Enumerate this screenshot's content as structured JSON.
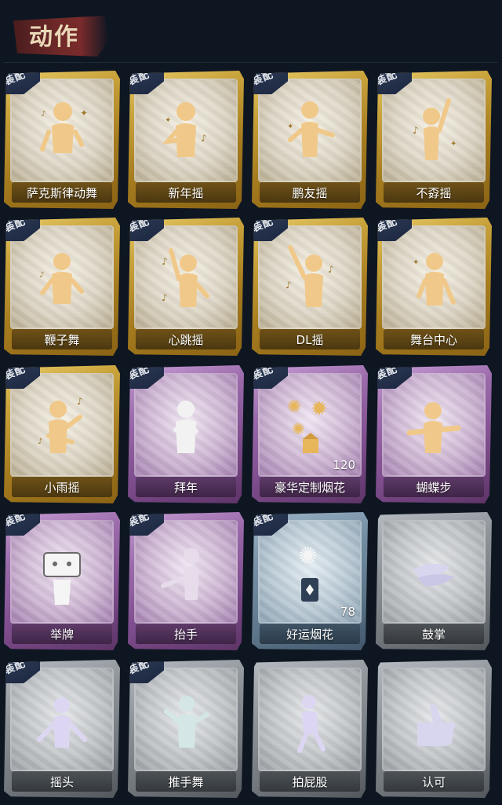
{
  "header": {
    "title": "动作"
  },
  "equip_label": "装配",
  "cards": [
    {
      "name": "萨克斯律动舞",
      "tier": "gold",
      "equipped": true,
      "icon": "saxophone-dance-icon"
    },
    {
      "name": "新年摇",
      "tier": "gold",
      "equipped": true,
      "icon": "new-year-sway-icon"
    },
    {
      "name": "鹏友摇",
      "tier": "gold",
      "equipped": true,
      "icon": "friend-sway-icon"
    },
    {
      "name": "不孬摇",
      "tier": "gold",
      "equipped": true,
      "icon": "cool-sway-icon"
    },
    {
      "name": "鞭子舞",
      "tier": "gold",
      "equipped": true,
      "icon": "whip-dance-icon"
    },
    {
      "name": "心跳摇",
      "tier": "gold",
      "equipped": true,
      "icon": "heartbeat-sway-icon"
    },
    {
      "name": "DL摇",
      "tier": "gold",
      "equipped": true,
      "icon": "dl-sway-icon"
    },
    {
      "name": "舞台中心",
      "tier": "gold",
      "equipped": true,
      "icon": "center-stage-icon"
    },
    {
      "name": "小雨摇",
      "tier": "gold",
      "equipped": true,
      "icon": "light-rain-sway-icon"
    },
    {
      "name": "拜年",
      "tier": "purple",
      "equipped": true,
      "icon": "new-year-greeting-icon"
    },
    {
      "name": "豪华定制烟花",
      "tier": "purple",
      "equipped": true,
      "icon": "fireworks-box-icon",
      "count": "120"
    },
    {
      "name": "蝴蝶步",
      "tier": "purple",
      "equipped": true,
      "icon": "butterfly-step-icon"
    },
    {
      "name": "举牌",
      "tier": "purple",
      "equipped": true,
      "icon": "hold-sign-icon"
    },
    {
      "name": "抬手",
      "tier": "purple",
      "equipped": true,
      "icon": "raise-hand-icon"
    },
    {
      "name": "好运烟花",
      "tier": "blue",
      "equipped": true,
      "icon": "lucky-firework-icon",
      "count": "78"
    },
    {
      "name": "鼓掌",
      "tier": "gray",
      "equipped": false,
      "icon": "clap-icon"
    },
    {
      "name": "摇头",
      "tier": "gray",
      "equipped": true,
      "icon": "shake-head-icon"
    },
    {
      "name": "推手舞",
      "tier": "gray",
      "equipped": true,
      "icon": "push-hand-dance-icon"
    },
    {
      "name": "拍屁股",
      "tier": "gray",
      "equipped": false,
      "icon": "butt-slap-icon"
    },
    {
      "name": "认可",
      "tier": "gray",
      "equipped": false,
      "icon": "thumbs-up-icon"
    }
  ],
  "colors": {
    "background": "#0e1622",
    "gold": "#c9a33b",
    "purple": "#9b6bab",
    "blue": "#748ea3",
    "gray": "#8d9398",
    "title_banner": "#6e2828"
  }
}
